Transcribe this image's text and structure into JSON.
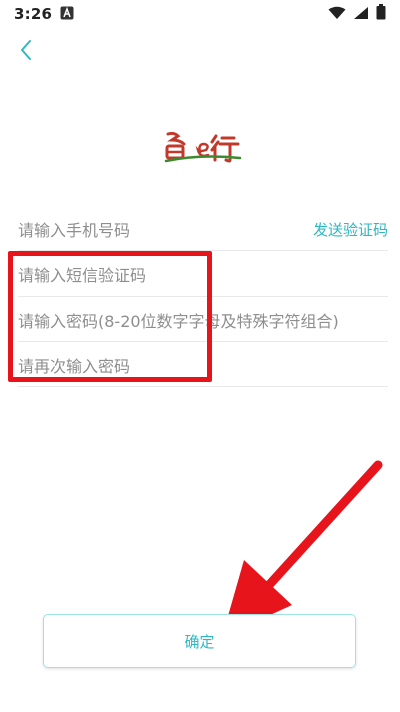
{
  "status_bar": {
    "time": "3:26",
    "icons": [
      "notification-a-icon",
      "wifi-icon",
      "signal-icon",
      "battery-icon"
    ]
  },
  "header": {
    "back_icon": "chevron-left-icon"
  },
  "logo": {
    "text": "鲁e行",
    "colors": {
      "red": "#c0392b",
      "green": "#3c8a2e"
    }
  },
  "form": {
    "phone_placeholder": "请输入手机号码",
    "send_code_label": "发送验证码",
    "sms_code_placeholder": "请输入短信验证码",
    "password_placeholder": "请输入密码(8-20位数字字母及特殊字符组合)",
    "confirm_password_placeholder": "请再次输入密码"
  },
  "actions": {
    "confirm_label": "确定"
  },
  "theme": {
    "accent": "#2fb7c2",
    "annotation_red": "#e8141c"
  }
}
